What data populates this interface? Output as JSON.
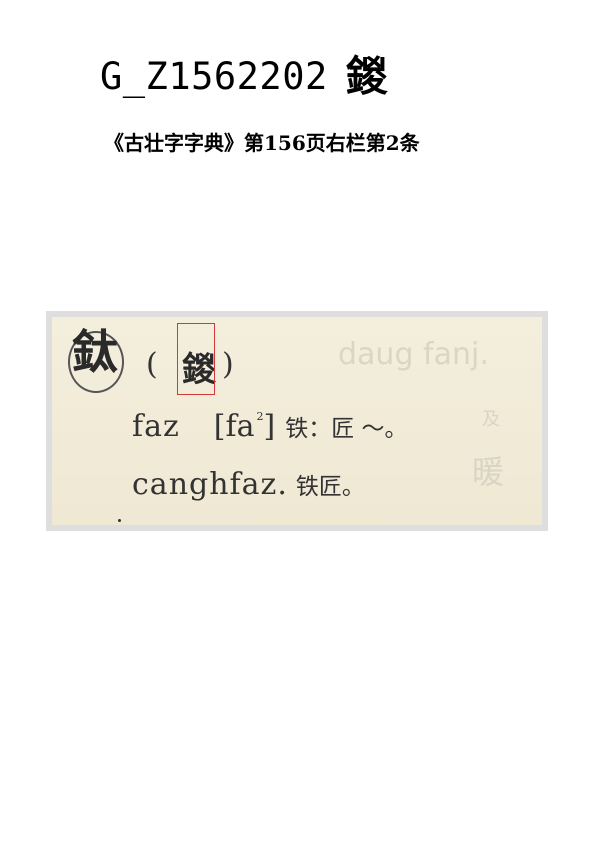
{
  "header": {
    "code": "G_Z1562202",
    "character": "鍐",
    "source": "《古壮字字典》第156页右栏第2条"
  },
  "scan": {
    "head_character": "鈦",
    "variant_character": "鍐",
    "open_paren": "(",
    "close_paren": ")",
    "line1": {
      "romanization": "faz",
      "ipa": "[fa",
      "tone": "2",
      "ipa_close": "]",
      "gloss": "铁：匠 ～。"
    },
    "line2": {
      "romanization": "canghfaz.",
      "gloss": "铁匠。"
    },
    "bleed_through": [
      "daug fanj.",
      "及",
      "暖"
    ]
  }
}
